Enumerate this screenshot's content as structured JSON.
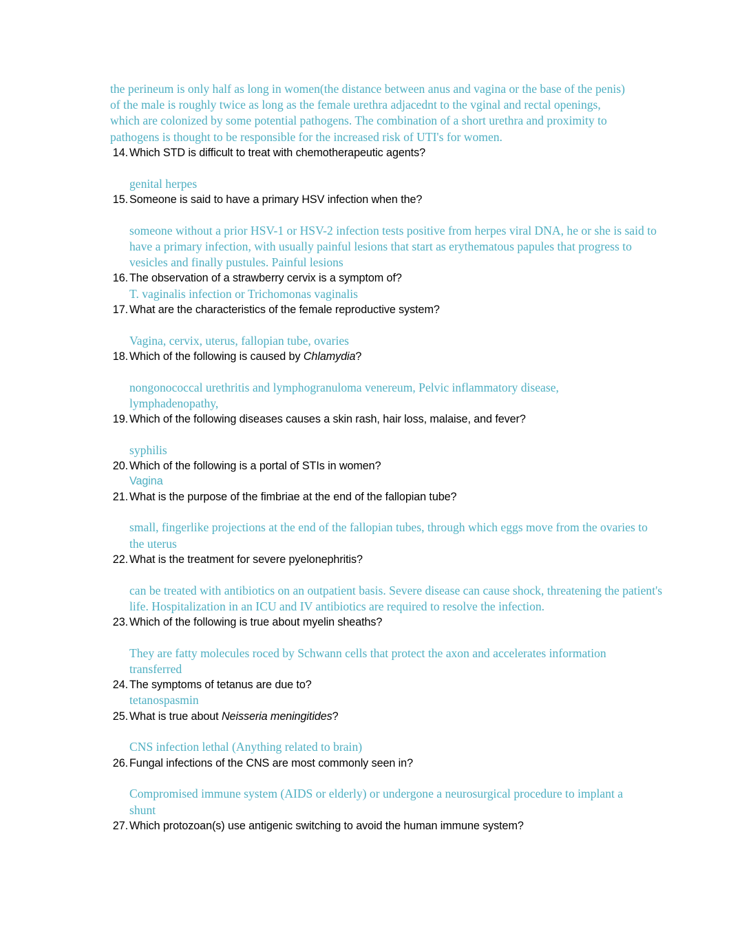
{
  "document": {
    "text_colors": {
      "question": "#000000",
      "answer": "#4FAFC2",
      "background": "#FFFFFF"
    },
    "lead_paragraph": "the perineum is only half as long in women(the distance between anus and vagina or the base of the penis) of the male is roughly twice as long as the female urethra adjacednt to the vginal and rectal openings, which are colonized by some potential pathogens. The combination of a short urethra and proximity to pathogens is thought to be responsible for the increased risk of UTI's for women.",
    "items": [
      {
        "number": "14.",
        "question": "Which STD is difficult to treat with chemotherapeutic agents?",
        "answer": "genital herpes",
        "answer_spacing": "gap",
        "answer_style": "serif"
      },
      {
        "number": "15.",
        "question": "Someone is said to have a primary HSV infection when the?",
        "answer": "someone without a prior HSV-1 or HSV-2 infection tests positive from herpes viral DNA, he or she is said to have a primary infection, with usually painful lesions that start as erythematous papules that progress to vesicles and finally pustules. Painful lesions",
        "answer_spacing": "gap",
        "answer_style": "serif"
      },
      {
        "number": "16.",
        "question": "The observation of a strawberry cervix is a symptom of?",
        "answer": "T. vaginalis infection or Trichomonas vaginalis",
        "answer_spacing": "tight",
        "answer_style": "serif"
      },
      {
        "number": "17.",
        "question": "What are the characteristics of the female reproductive system?",
        "answer": "Vagina, cervix, uterus, fallopian tube, ovaries",
        "answer_spacing": "gap",
        "answer_style": "serif"
      },
      {
        "number": "18.",
        "question_prefix": "Which of the following is caused by ",
        "question_italic": "Chlamydia",
        "question_suffix": "?",
        "question": "Which of the following is caused by Chlamydia?",
        "answer": "nongonococcal urethritis and lymphogranuloma venereum, Pelvic inflammatory disease, lymphadenopathy,",
        "answer_spacing": "gap",
        "answer_style": "serif"
      },
      {
        "number": "19.",
        "question": "Which of the following diseases causes a skin rash, hair loss, malaise, and fever?",
        "answer": "syphilis",
        "answer_spacing": "gap",
        "answer_style": "serif"
      },
      {
        "number": "20.",
        "question": "Which of the following is a portal of STIs in women?",
        "answer": "Vagina",
        "answer_spacing": "tight",
        "answer_style": "sans"
      },
      {
        "number": "21.",
        "question": "What is the purpose of the fimbriae at the end of the fallopian tube?",
        "answer": "small, fingerlike projections at the end of the fallopian tubes, through which eggs move from the ovaries to the uterus",
        "answer_spacing": "gap",
        "answer_style": "serif"
      },
      {
        "number": "22.",
        "question": "What is the treatment for severe pyelonephritis?",
        "answer": "can be treated with antibiotics on an outpatient basis. Severe disease can cause shock, threatening the patient's life. Hospitalization in an ICU and IV antibiotics are required to resolve the infection.",
        "answer_spacing": "gap",
        "answer_style": "serif"
      },
      {
        "number": "23.",
        "question": "Which of the following is true about myelin sheaths?",
        "answer": "They are fatty molecules roced by Schwann cells that protect the axon and accelerates information transferred",
        "answer_spacing": "gap",
        "answer_style": "serif"
      },
      {
        "number": "24.",
        "question": "The symptoms of tetanus are due to?",
        "answer": "tetanospasmin",
        "answer_spacing": "tight",
        "answer_style": "serif"
      },
      {
        "number": "25.",
        "question_prefix": "What is true about ",
        "question_italic": "Neisseria meningitides",
        "question_suffix": "?",
        "question": "What is true about Neisseria meningitides?",
        "answer": "CNS infection lethal (Anything related to brain)",
        "answer_spacing": "gap",
        "answer_style": "serif"
      },
      {
        "number": "26.",
        "question": "Fungal infections of the CNS are most commonly seen in?",
        "answer": "Compromised immune system (AIDS or elderly) or undergone a neurosurgical procedure to implant a shunt",
        "answer_spacing": "gap",
        "answer_style": "serif"
      },
      {
        "number": "27.",
        "question": "Which protozoan(s) use antigenic switching to avoid the human immune system?",
        "answer": "",
        "answer_spacing": "none",
        "answer_style": "serif"
      }
    ]
  }
}
